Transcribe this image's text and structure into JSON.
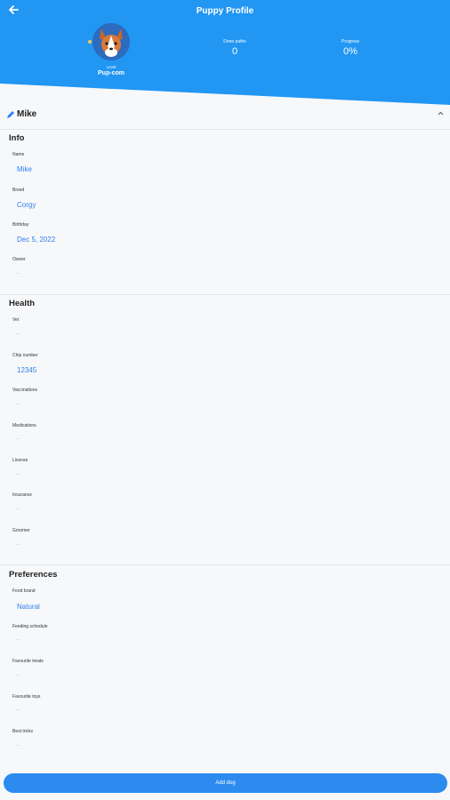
{
  "header": {
    "title": "Puppy Profile",
    "back_icon": "arrow-left-icon",
    "accent": "#2196f3",
    "level_label": "Level",
    "level_value": "Pup-com",
    "stats": [
      {
        "label": "Done paths",
        "value": "0"
      },
      {
        "label": "Progress",
        "value": "0%"
      }
    ]
  },
  "dog": {
    "name": "Mike"
  },
  "sections": {
    "info": {
      "title": "Info",
      "fields": [
        {
          "label": "Name",
          "value": "Mike"
        },
        {
          "label": "Breed",
          "value": "Corgy"
        },
        {
          "label": "Birthday",
          "value": "Dec 5, 2022"
        },
        {
          "label": "Owner",
          "value": "-"
        }
      ]
    },
    "health": {
      "title": "Health",
      "fields": [
        {
          "label": "Vet",
          "value": "-"
        },
        {
          "label": "Chip number",
          "value": "12345"
        },
        {
          "label": "Vaccinations",
          "value": "-"
        },
        {
          "label": "Medications",
          "value": "-"
        },
        {
          "label": "License",
          "value": "-"
        },
        {
          "label": "Insurance",
          "value": "-"
        },
        {
          "label": "Groomer",
          "value": "-"
        }
      ]
    },
    "preferences": {
      "title": "Preferences",
      "fields": [
        {
          "label": "Food brand",
          "value": "Natural"
        },
        {
          "label": "Feeding schedule",
          "value": "-"
        },
        {
          "label": "Favourite treats",
          "value": "-"
        },
        {
          "label": "Favourite toys",
          "value": "-"
        },
        {
          "label": "Best tricks",
          "value": "-"
        }
      ]
    }
  },
  "footer": {
    "add_label": "Add dog"
  }
}
